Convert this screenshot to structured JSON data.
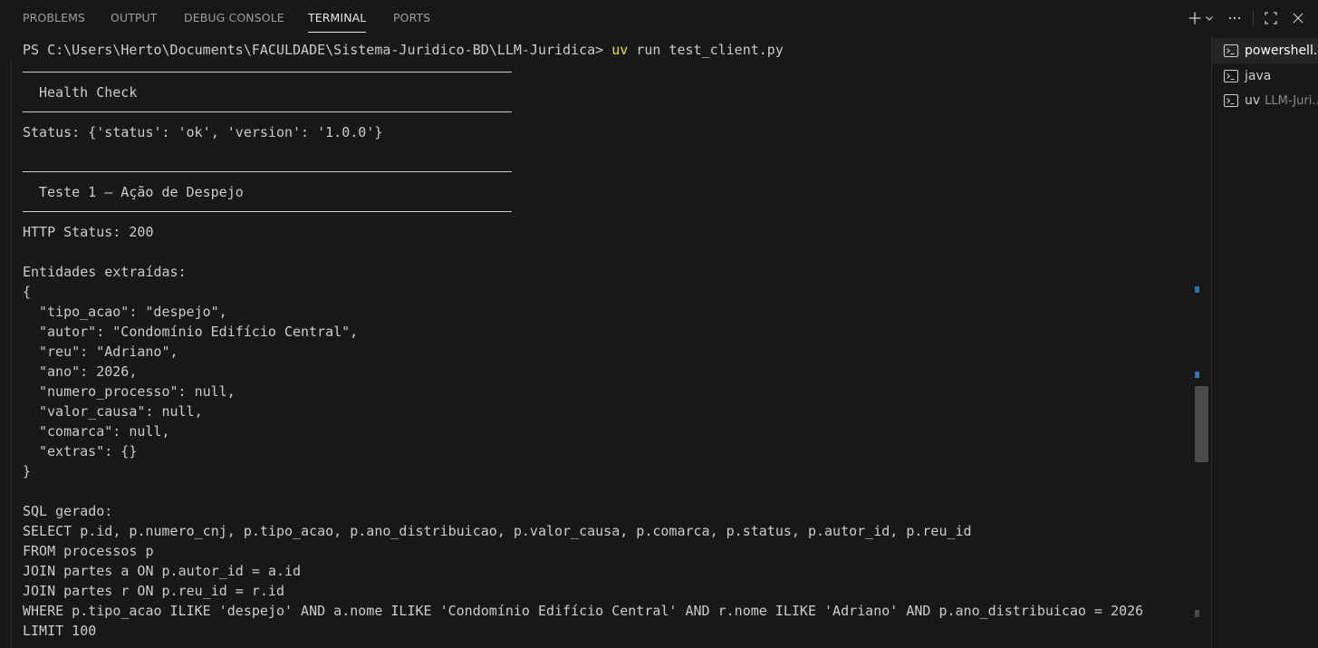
{
  "panel": {
    "tabs": [
      {
        "label": "PROBLEMS",
        "active": false
      },
      {
        "label": "OUTPUT",
        "active": false
      },
      {
        "label": "DEBUG CONSOLE",
        "active": false
      },
      {
        "label": "TERMINAL",
        "active": true
      },
      {
        "label": "PORTS",
        "active": false
      }
    ],
    "actions": [
      {
        "name": "new-terminal",
        "icon": "plus-icon"
      },
      {
        "name": "launch-profile",
        "icon": "chevron-down-icon"
      },
      {
        "name": "more-actions",
        "icon": "ellipsis-icon"
      },
      {
        "name": "maximize-panel",
        "icon": "maximize-icon"
      },
      {
        "name": "close-panel",
        "icon": "close-icon"
      }
    ]
  },
  "terminal": {
    "prompt": "PS C:\\Users\\Herto\\Documents\\FACULDADE\\Sistema-Juridico-BD\\LLM-Juridica> ",
    "command_bin": "uv",
    "command_args": " run test_client.py",
    "health_heading": "Health Check",
    "status_line": "Status: {'status': 'ok', 'version': '1.0.0'}",
    "test1_heading": "Teste 1 — Ação de Despejo",
    "http_status": "HTTP Status: 200",
    "entities_label": "Entidades extraídas:",
    "json_open": "{",
    "json_lines": [
      "\"tipo_acao\": \"despejo\",",
      "\"autor\": \"Condomínio Edifício Central\",",
      "\"reu\": \"Adriano\",",
      "\"ano\": 2026,",
      "\"numero_processo\": null,",
      "\"valor_causa\": null,",
      "\"comarca\": null,",
      "\"extras\": {}"
    ],
    "json_close": "}",
    "sql_label": "SQL gerado:",
    "sql_lines": [
      "SELECT p.id, p.numero_cnj, p.tipo_acao, p.ano_distribuicao, p.valor_causa, p.comarca, p.status, p.autor_id, p.reu_id",
      "FROM processos p",
      "JOIN partes a ON p.autor_id = a.id",
      "JOIN partes r ON p.reu_id = r.id",
      "WHERE p.tipo_acao ILIKE 'despejo' AND a.nome ILIKE 'Condomínio Edifício Central' AND r.nome ILIKE 'Adriano' AND p.ano_distribuicao = 2026",
      "LIMIT 100"
    ]
  },
  "terminal_list": [
    {
      "label": "powershell...",
      "description": "",
      "active": true,
      "icon": "terminal-icon"
    },
    {
      "label": "java",
      "description": "",
      "active": false,
      "icon": "terminal-icon"
    },
    {
      "label": "uv",
      "description": "LLM-Juri...",
      "active": false,
      "icon": "terminal-icon"
    }
  ],
  "colors": {
    "background": "#181818",
    "text": "#cccccc",
    "command_highlight": "#e5e510",
    "scroll_mark": "#1f78c8"
  }
}
